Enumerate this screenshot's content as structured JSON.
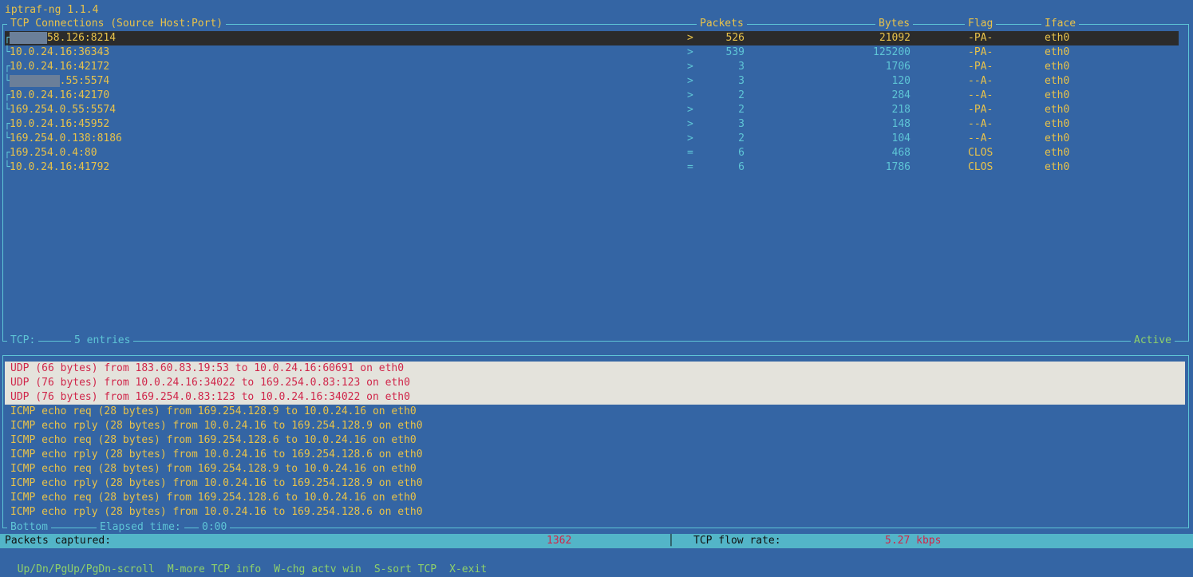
{
  "app": {
    "title": "iptraf-ng 1.1.4"
  },
  "tcp_window": {
    "headers": {
      "connections": "TCP Connections (Source Host:Port)",
      "packets": "Packets",
      "bytes": "Bytes",
      "flag": "Flag",
      "iface": "Iface"
    },
    "rows": [
      {
        "src_hidden": "xxx.xx",
        "src": "58.126:8214",
        "dir": ">",
        "packets": "526",
        "bytes": "21092",
        "flag": "-PA-",
        "iface": "eth0",
        "tree": "┌"
      },
      {
        "src_hidden": "",
        "src": "10.0.24.16:36343",
        "dir": ">",
        "packets": "539",
        "bytes": "125200",
        "flag": "-PA-",
        "iface": "eth0",
        "tree": "└"
      },
      {
        "src_hidden": "",
        "src": "10.0.24.16:42172",
        "dir": ">",
        "packets": "3",
        "bytes": "1706",
        "flag": "-PA-",
        "iface": "eth0",
        "tree": "┌"
      },
      {
        "src_hidden": "xxx.xxx.",
        "src": ".55:5574",
        "dir": ">",
        "packets": "3",
        "bytes": "120",
        "flag": "--A-",
        "iface": "eth0",
        "tree": "└"
      },
      {
        "src_hidden": "",
        "src": "10.0.24.16:42170",
        "dir": ">",
        "packets": "2",
        "bytes": "284",
        "flag": "--A-",
        "iface": "eth0",
        "tree": "┌"
      },
      {
        "src_hidden": "",
        "src": "169.254.0.55:5574",
        "dir": ">",
        "packets": "2",
        "bytes": "218",
        "flag": "-PA-",
        "iface": "eth0",
        "tree": "└"
      },
      {
        "src_hidden": "",
        "src": "10.0.24.16:45952",
        "dir": ">",
        "packets": "3",
        "bytes": "148",
        "flag": "--A-",
        "iface": "eth0",
        "tree": "┌"
      },
      {
        "src_hidden": "",
        "src": "169.254.0.138:8186",
        "dir": ">",
        "packets": "2",
        "bytes": "104",
        "flag": "--A-",
        "iface": "eth0",
        "tree": "└"
      },
      {
        "src_hidden": "",
        "src": "169.254.0.4:80",
        "dir": "=",
        "packets": "6",
        "bytes": "468",
        "flag": "CLOS",
        "iface": "eth0",
        "tree": "┌"
      },
      {
        "src_hidden": "",
        "src": "10.0.24.16:41792",
        "dir": "=",
        "packets": "6",
        "bytes": "1786",
        "flag": "CLOS",
        "iface": "eth0",
        "tree": "└"
      }
    ],
    "footer": {
      "label": "TCP:",
      "entries": "5 entries",
      "state": "Active"
    }
  },
  "other_window": {
    "packets": [
      "UDP (66 bytes) from 183.60.83.19:53 to 10.0.24.16:60691 on eth0",
      "UDP (76 bytes) from 10.0.24.16:34022 to 169.254.0.83:123 on eth0",
      "UDP (76 bytes) from 169.254.0.83:123 to 10.0.24.16:34022 on eth0",
      "ICMP echo req (28 bytes) from 169.254.128.9 to 10.0.24.16 on eth0",
      "ICMP echo rply (28 bytes) from 10.0.24.16 to 169.254.128.9 on eth0",
      "ICMP echo req (28 bytes) from 169.254.128.6 to 10.0.24.16 on eth0",
      "ICMP echo rply (28 bytes) from 10.0.24.16 to 169.254.128.6 on eth0",
      "ICMP echo req (28 bytes) from 169.254.128.9 to 10.0.24.16 on eth0",
      "ICMP echo rply (28 bytes) from 10.0.24.16 to 169.254.128.9 on eth0",
      "ICMP echo req (28 bytes) from 169.254.128.6 to 10.0.24.16 on eth0",
      "ICMP echo rply (28 bytes) from 10.0.24.16 to 169.254.128.6 on eth0"
    ],
    "footer": {
      "position": "Bottom",
      "elapsed_label": "Elapsed time:",
      "elapsed_value": "0:00"
    }
  },
  "status": {
    "packets_label": "Packets captured:",
    "packets_value": "1362",
    "separator": "│",
    "flow_label": "TCP flow rate:",
    "flow_value": "5.27 kbps"
  },
  "keys": [
    "Up/Dn/PgUp/PgDn-scroll",
    "M-more TCP info",
    "W-chg actv win",
    "S-sort TCP",
    "X-exit"
  ],
  "colors": {
    "background": "#3465a4",
    "text_yellow": "#e8c24a",
    "text_cyan": "#5ec5d6",
    "text_red": "#d0264a",
    "highlight_row": "#2b2b2b",
    "udp_box": "#e4e3dc",
    "status_bar": "#53b5c8"
  }
}
